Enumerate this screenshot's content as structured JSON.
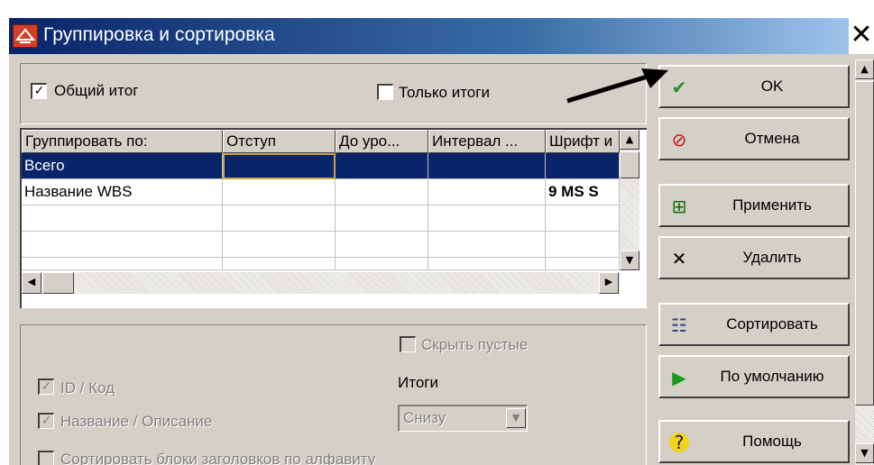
{
  "window": {
    "title": "Группировка и сортировка",
    "close_glyph": "✕"
  },
  "top_options": {
    "total_label": "Общий итог",
    "total_checked": true,
    "only_totals_label": "Только итоги",
    "only_totals_checked": false
  },
  "grid": {
    "columns": [
      "Группировать по:",
      "Отступ",
      "До уро...",
      "Интервал ...",
      "Шрифт и"
    ],
    "rows": [
      {
        "group_by": "Всего",
        "indent": "",
        "level": "",
        "interval": "",
        "font": ""
      },
      {
        "group_by": "Название WBS",
        "indent": "",
        "level": "",
        "interval": "",
        "font": "9 MS S"
      }
    ]
  },
  "bottom_options": {
    "hide_empty_label": "Скрыть пустые",
    "id_code_label": "ID / Код",
    "name_desc_label": "Название / Описание",
    "totals_label": "Итоги",
    "totals_value": "Снизу",
    "sort_headers_label": "Сортировать блоки заголовков по алфавиту"
  },
  "buttons": {
    "ok": "OK",
    "cancel": "Отмена",
    "apply": "Применить",
    "delete": "Удалить",
    "sort": "Сортировать",
    "default": "По умолчанию",
    "help": "Помощь"
  },
  "icons": {
    "app": "app-logo-icon",
    "ok": "checkmark-icon",
    "cancel": "no-entry-icon",
    "apply": "apply-icon",
    "delete": "x-icon",
    "sort": "sort-icon",
    "default": "play-icon",
    "help": "help-icon"
  },
  "colors": {
    "title_bar": "#0a246a",
    "selection": "#0a246a",
    "dialog_face": "#d4d0c8"
  }
}
